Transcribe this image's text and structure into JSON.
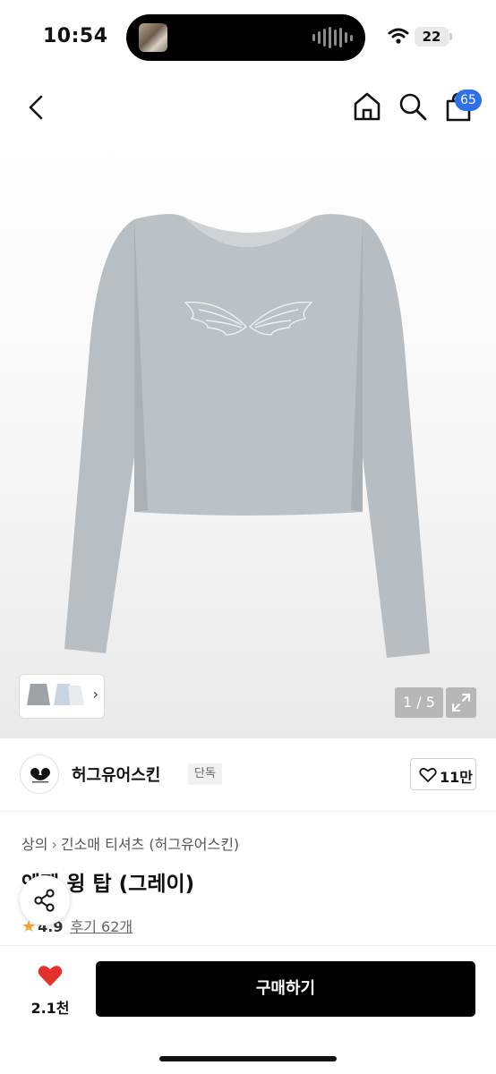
{
  "status_bar": {
    "time": "10:54",
    "battery": "22"
  },
  "nav": {
    "back_icon": "chevron-left-icon",
    "home_icon": "home-icon",
    "search_icon": "search-icon",
    "cart_icon": "shopping-bag-icon",
    "cart_count": "65",
    "accent_color": "#2f6fea"
  },
  "gallery": {
    "counter": "1 / 5",
    "expand_icon": "expand-icon",
    "product_color": "#b9bec2"
  },
  "brand": {
    "name": "허그유어스킨",
    "tag": "단독",
    "like_count": "11만"
  },
  "breadcrumb": {
    "category": "상의",
    "subcategory": "긴소매 티셔츠 (허그유어스킨)"
  },
  "product": {
    "title": "엔젤 윙 탑 (그레이)",
    "rating": "4.9",
    "reviews": "후기 62개"
  },
  "bottom_bar": {
    "favorite_count": "2.1천",
    "buy_label": "구매하기"
  }
}
